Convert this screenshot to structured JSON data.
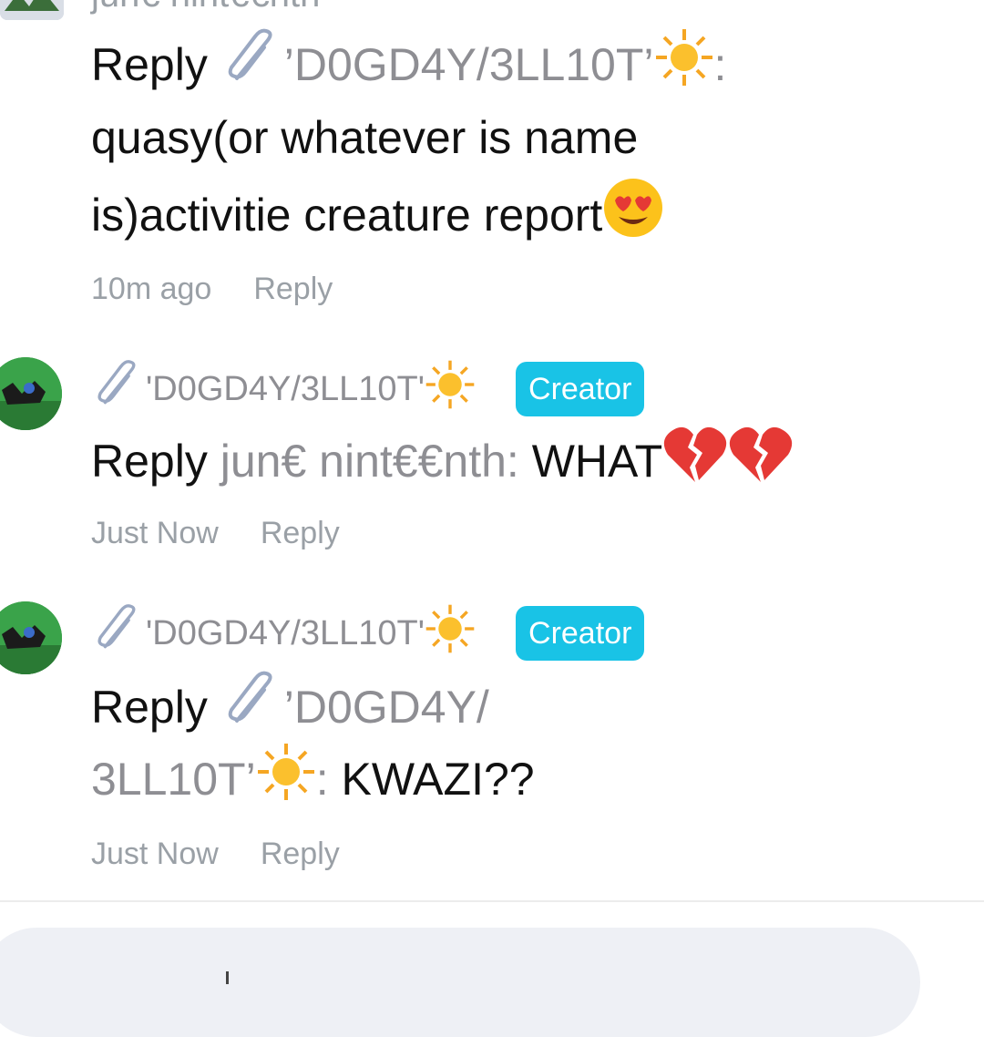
{
  "app": {
    "accent": "#19c3e6",
    "muted": "#8e8e93"
  },
  "top_partial": {
    "author_cut": "jun€ nint€€nth"
  },
  "comments": [
    {
      "reply_word": "Reply",
      "reply_to": "’D0GD4Y/3LL10T’",
      "text_line1": "quasy(or whatever is name",
      "text_line2": "is)activitie creature report",
      "emoji": "heart-eyes-emoji",
      "time": "10m ago",
      "reply_action": "Reply"
    },
    {
      "username": "'D0GD4Y/3LL10T'",
      "badge": "Creator",
      "reply_word": "Reply",
      "reply_to": "jun€ nint€€nth",
      "text": "WHAT",
      "emoji": "broken-heart-emoji",
      "time": "Just Now",
      "reply_action": "Reply"
    },
    {
      "username": "'D0GD4Y/3LL10T'",
      "badge": "Creator",
      "reply_word": "Reply",
      "reply_to_line1": "’D0GD4Y/",
      "reply_to_line2": "3LL10T’",
      "text": "KWAZI??",
      "time": "Just Now",
      "reply_action": "Reply"
    }
  ],
  "input": {
    "placeholder": ""
  }
}
